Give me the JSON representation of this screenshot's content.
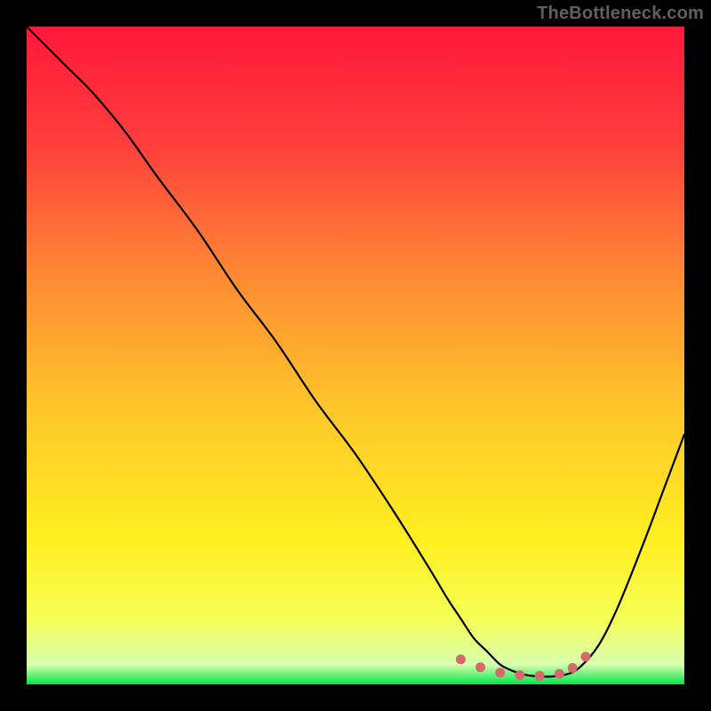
{
  "watermark": "TheBottleneck.com",
  "colors": {
    "frame_bg": "#000000",
    "curve": "#000000",
    "marker": "#d66a6a",
    "gradient_stops": [
      {
        "offset": "0%",
        "color": "#ff173a"
      },
      {
        "offset": "18%",
        "color": "#ff3f3c"
      },
      {
        "offset": "38%",
        "color": "#ff8a34"
      },
      {
        "offset": "58%",
        "color": "#ffc62a"
      },
      {
        "offset": "78%",
        "color": "#ffef20"
      },
      {
        "offset": "90%",
        "color": "#f6ff55"
      },
      {
        "offset": "97%",
        "color": "#d7ffb0"
      },
      {
        "offset": "100%",
        "color": "#00e64a"
      }
    ]
  },
  "chart_data": {
    "type": "line",
    "title": "",
    "xlabel": "",
    "ylabel": "",
    "xlim": [
      0,
      100
    ],
    "ylim": [
      0,
      100
    ],
    "series": [
      {
        "name": "bottleneck-curve",
        "x": [
          0,
          3,
          6,
          10,
          15,
          20,
          26,
          32,
          38,
          44,
          50,
          56,
          61,
          64,
          66,
          68,
          70,
          72,
          74,
          76,
          78,
          80,
          82,
          84,
          87,
          90,
          94,
          97,
          100
        ],
        "y": [
          100,
          97,
          94,
          90,
          84,
          77,
          69,
          60,
          52,
          43,
          35,
          26,
          18,
          13,
          10,
          7,
          5,
          3,
          2,
          1.4,
          1.2,
          1.2,
          1.5,
          2.5,
          6,
          12,
          22,
          30,
          38
        ]
      }
    ],
    "markers": {
      "name": "near-minimum-dots",
      "color": "#d66a6a",
      "points": [
        {
          "x": 66,
          "y": 3.8
        },
        {
          "x": 69,
          "y": 2.6
        },
        {
          "x": 72,
          "y": 1.8
        },
        {
          "x": 75,
          "y": 1.4
        },
        {
          "x": 78,
          "y": 1.3
        },
        {
          "x": 81,
          "y": 1.6
        },
        {
          "x": 83,
          "y": 2.5
        },
        {
          "x": 85,
          "y": 4.2
        }
      ]
    }
  }
}
